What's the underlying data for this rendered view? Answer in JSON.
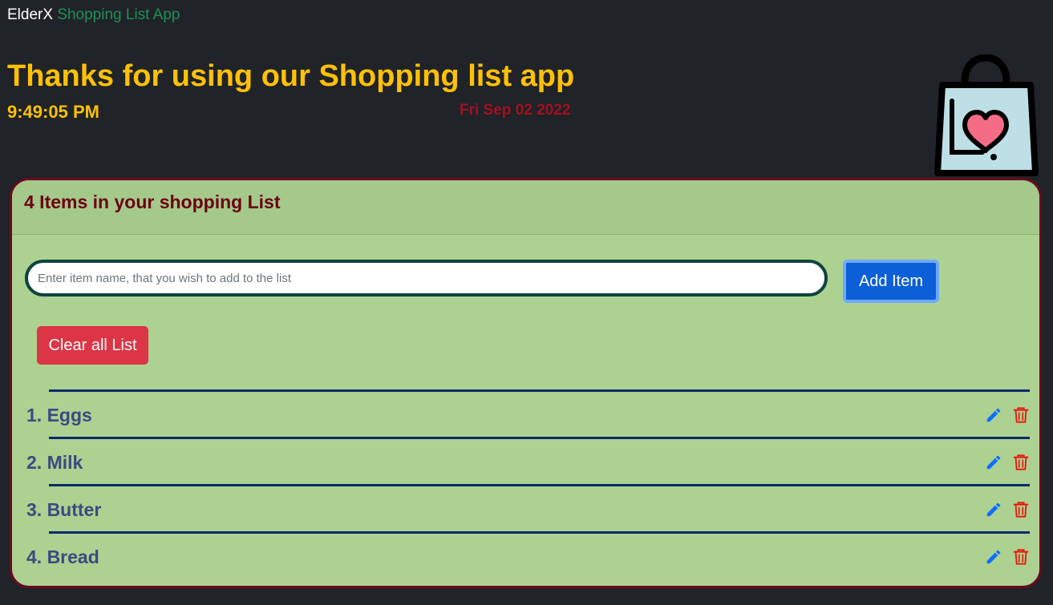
{
  "navbar": {
    "brand_name": "ElderX",
    "app_name": "Shopping List App"
  },
  "header": {
    "headline": "Thanks for using our Shopping list app",
    "time": "9:49:05 PM",
    "date": "Fri Sep 02 2022",
    "logo_icon": "shopping-bag-heart-icon"
  },
  "card": {
    "title": "4 Items in your shopping List",
    "input_placeholder": "Enter item name, that you wish to add to the list",
    "input_value": "",
    "add_button_label": "Add Item",
    "clear_button_label": "Clear all List",
    "items": [
      {
        "label": "1. Eggs"
      },
      {
        "label": "2. Milk"
      },
      {
        "label": "3. Butter"
      },
      {
        "label": "4. Bread"
      }
    ],
    "edit_icon": "pencil-icon",
    "delete_icon": "trash-icon"
  },
  "colors": {
    "background": "#202328",
    "accent_yellow": "#ffc107",
    "card_green": "#acd190",
    "card_border": "#6b0a1e",
    "primary_blue": "#0d5fd8",
    "danger_red": "#dc3545",
    "item_text": "#3c4a82",
    "divider": "#0a2a6b"
  }
}
